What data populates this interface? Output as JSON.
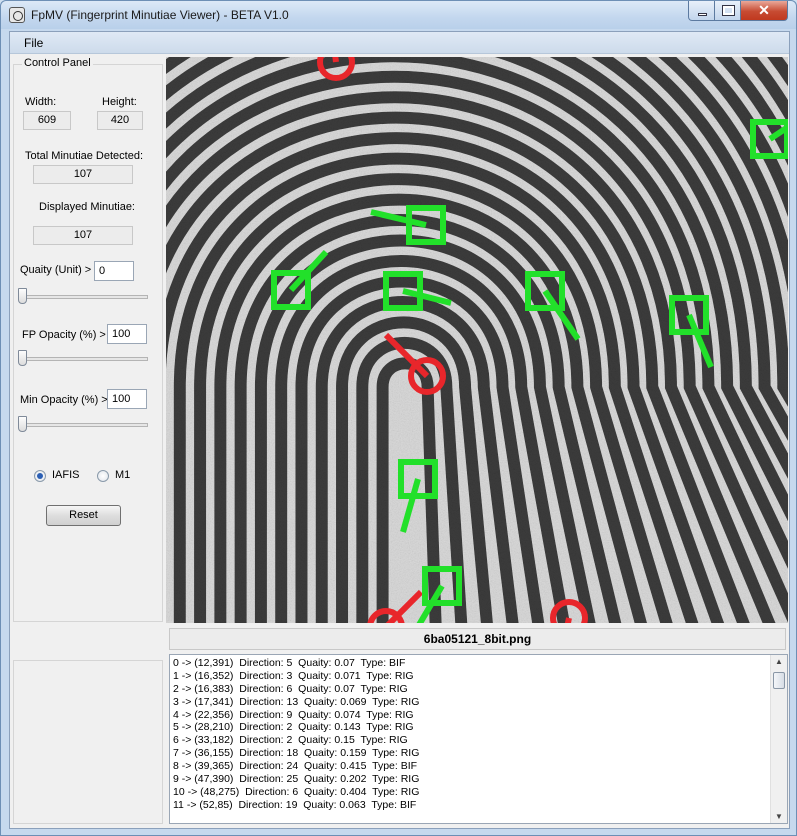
{
  "window": {
    "title": "FpMV (Fingerprint Minutiae Viewer) - BETA V1.0",
    "close_glyph": "✕"
  },
  "menu": {
    "file": "File"
  },
  "panel": {
    "title": "Control Panel",
    "width_label": "Width:",
    "width_value": "609",
    "height_label": "Height:",
    "height_value": "420",
    "total_label": "Total Minutiae Detected:",
    "total_value": "107",
    "displayed_label": "Displayed Minutiae:",
    "displayed_value": "107",
    "quality_label": "Quaity (Unit) >",
    "quality_value": "0",
    "quality_slider": 0,
    "fp_opacity_label": "FP Opacity (%)  >",
    "fp_opacity_value": "100",
    "fp_opacity_slider": 0,
    "min_opacity_label": "Min Opacity (%) >",
    "min_opacity_value": "100",
    "min_opacity_slider": 0,
    "radio_iafis": "IAFIS",
    "radio_m1": "M1",
    "selected_format": "IAFIS",
    "reset": "Reset"
  },
  "colors": {
    "bifurcation": "#e8262b",
    "ridge_ending": "#22e02a"
  },
  "image": {
    "filename": "6ba05121_8bit.png"
  },
  "minutiae_list": [
    "0 -> (12,391)  Direction: 5  Quaity: 0.07  Type: BIF",
    "1 -> (16,352)  Direction: 3  Quaity: 0.071  Type: RIG",
    "2 -> (16,383)  Direction: 6  Quaity: 0.07  Type: RIG",
    "3 -> (17,341)  Direction: 13  Quaity: 0.069  Type: RIG",
    "4 -> (22,356)  Direction: 9  Quaity: 0.074  Type: RIG",
    "5 -> (28,210)  Direction: 2  Quaity: 0.143  Type: RIG",
    "6 -> (33,182)  Direction: 2  Quaity: 0.15  Type: RIG",
    "7 -> (36,155)  Direction: 18  Quaity: 0.159  Type: RIG",
    "8 -> (39,365)  Direction: 24  Quaity: 0.415  Type: BIF",
    "9 -> (47,390)  Direction: 25  Quaity: 0.202  Type: RIG",
    "10 -> (48,275)  Direction: 6  Quaity: 0.404  Type: RIG",
    "11 -> (52,85)  Direction: 19  Quaity: 0.063  Type: BIF"
  ]
}
